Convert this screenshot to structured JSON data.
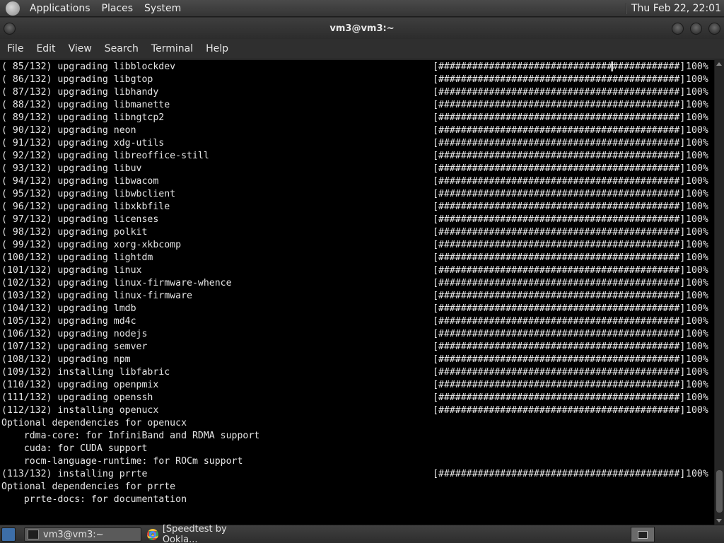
{
  "top_panel": {
    "menus": [
      "Applications",
      "Places",
      "System"
    ],
    "clock": "Thu Feb 22, 22:01"
  },
  "window": {
    "title": "vm3@vm3:~",
    "menu": [
      "File",
      "Edit",
      "View",
      "Search",
      "Terminal",
      "Help"
    ]
  },
  "terminal": {
    "progress_bar": "[###########################################]",
    "lines": [
      {
        "pkg": "( 85/132) upgrading libblockdev",
        "pct": "100%"
      },
      {
        "pkg": "( 86/132) upgrading libgtop",
        "pct": "100%"
      },
      {
        "pkg": "( 87/132) upgrading libhandy",
        "pct": "100%"
      },
      {
        "pkg": "( 88/132) upgrading libmanette",
        "pct": "100%"
      },
      {
        "pkg": "( 89/132) upgrading libngtcp2",
        "pct": "100%"
      },
      {
        "pkg": "( 90/132) upgrading neon",
        "pct": "100%"
      },
      {
        "pkg": "( 91/132) upgrading xdg-utils",
        "pct": "100%"
      },
      {
        "pkg": "( 92/132) upgrading libreoffice-still",
        "pct": "100%"
      },
      {
        "pkg": "( 93/132) upgrading libuv",
        "pct": "100%"
      },
      {
        "pkg": "( 94/132) upgrading libwacom",
        "pct": "100%"
      },
      {
        "pkg": "( 95/132) upgrading libwbclient",
        "pct": "100%"
      },
      {
        "pkg": "( 96/132) upgrading libxkbfile",
        "pct": "100%"
      },
      {
        "pkg": "( 97/132) upgrading licenses",
        "pct": "100%"
      },
      {
        "pkg": "( 98/132) upgrading polkit",
        "pct": "100%"
      },
      {
        "pkg": "( 99/132) upgrading xorg-xkbcomp",
        "pct": "100%"
      },
      {
        "pkg": "(100/132) upgrading lightdm",
        "pct": "100%"
      },
      {
        "pkg": "(101/132) upgrading linux",
        "pct": "100%"
      },
      {
        "pkg": "(102/132) upgrading linux-firmware-whence",
        "pct": "100%"
      },
      {
        "pkg": "(103/132) upgrading linux-firmware",
        "pct": "100%"
      },
      {
        "pkg": "(104/132) upgrading lmdb",
        "pct": "100%"
      },
      {
        "pkg": "(105/132) upgrading md4c",
        "pct": "100%"
      },
      {
        "pkg": "(106/132) upgrading nodejs",
        "pct": "100%"
      },
      {
        "pkg": "(107/132) upgrading semver",
        "pct": "100%"
      },
      {
        "pkg": "(108/132) upgrading npm",
        "pct": "100%"
      },
      {
        "pkg": "(109/132) installing libfabric",
        "pct": "100%"
      },
      {
        "pkg": "(110/132) upgrading openpmix",
        "pct": "100%"
      },
      {
        "pkg": "(111/132) upgrading openssh",
        "pct": "100%"
      },
      {
        "pkg": "(112/132) installing openucx",
        "pct": "100%"
      },
      {
        "pkg": "Optional dependencies for openucx",
        "pct": ""
      },
      {
        "pkg": "    rdma-core: for InfiniBand and RDMA support",
        "pct": ""
      },
      {
        "pkg": "    cuda: for CUDA support",
        "pct": ""
      },
      {
        "pkg": "    rocm-language-runtime: for ROCm support",
        "pct": ""
      },
      {
        "pkg": "(113/132) installing prrte",
        "pct": "100%"
      },
      {
        "pkg": "Optional dependencies for prrte",
        "pct": ""
      },
      {
        "pkg": "    prrte-docs: for documentation",
        "pct": ""
      }
    ]
  },
  "taskbar": {
    "tasks": [
      "vm3@vm3:~",
      "[Speedtest by Ookla..."
    ]
  }
}
